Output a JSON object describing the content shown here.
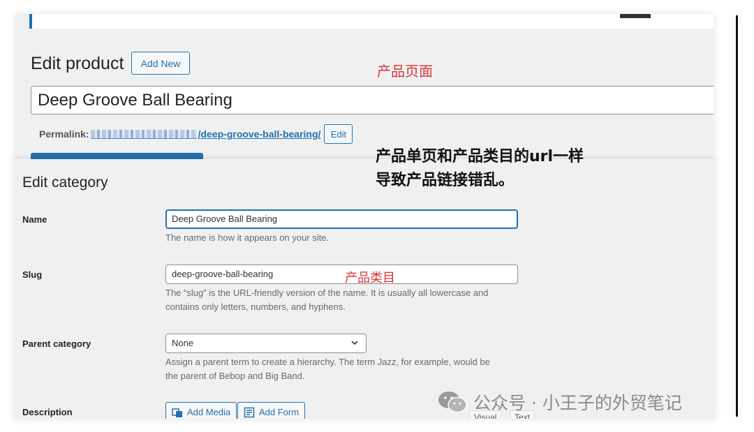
{
  "product_page": {
    "title": "Edit product",
    "add_new_label": "Add New",
    "product_name_value": "Deep Groove Ball Bearing",
    "permalink_label": "Permalink:",
    "permalink_slug": "/deep-groove-ball-bearing/",
    "edit_label": "Edit"
  },
  "category_page": {
    "title": "Edit category",
    "name_label": "Name",
    "name_value": "Deep Groove Ball Bearing",
    "name_help": "The name is how it appears on your site.",
    "slug_label": "Slug",
    "slug_value": "deep-groove-ball-bearing",
    "slug_help_line1": "The “slug” is the URL-friendly version of the name. It is usually all lowercase and",
    "slug_help_line2": "contains only letters, numbers, and hyphens.",
    "parent_label": "Parent category",
    "parent_value": "None",
    "parent_help_line1": "Assign a parent term to create a hierarchy. The term Jazz, for example, would be",
    "parent_help_line2": "the parent of Bebop and Big Band.",
    "description_label": "Description",
    "add_media_label": "Add Media",
    "add_form_label": "Add Form",
    "visual_tab": "Visual",
    "text_tab": "Text"
  },
  "annotations": {
    "product_page_note": "产品页面",
    "main_note_line1": "产品单页和产品类目的url一样",
    "main_note_line2": "导致产品链接错乱。",
    "category_note": "产品类目"
  },
  "watermark": {
    "text": "公众号 · 小王子的外贸笔记",
    "icon": "wechat-icon"
  },
  "colors": {
    "wp_blue": "#2271b1",
    "annotation_red": "#d63638",
    "admin_bg": "#f0f0f1"
  }
}
